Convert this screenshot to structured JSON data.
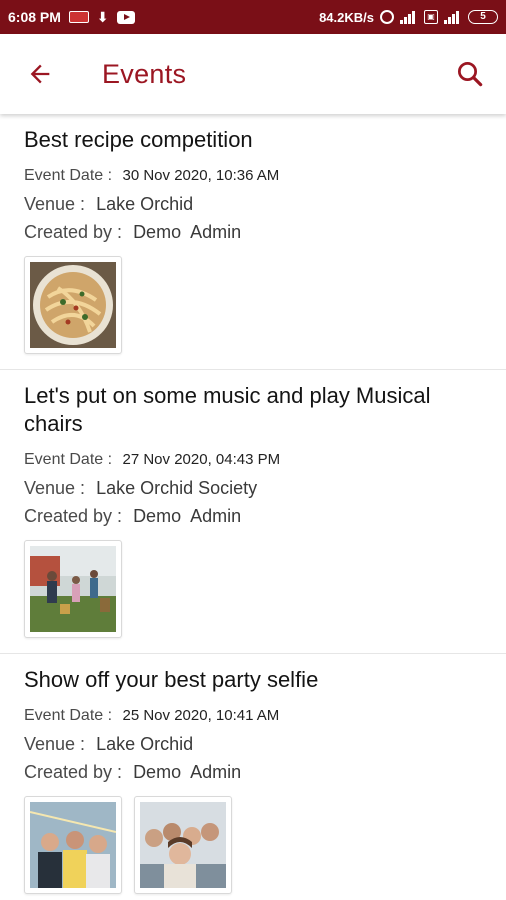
{
  "status_bar": {
    "time": "6:08 PM",
    "net_speed": "84.2KB/s",
    "battery": "5"
  },
  "header": {
    "title": "Events"
  },
  "labels": {
    "event_date": "Event Date : ",
    "venue": "Venue : ",
    "created_by": "Created by : "
  },
  "events": [
    {
      "title": "Best recipe competition",
      "date": "30 Nov 2020, 10:36 AM",
      "venue": "Lake Orchid",
      "created_by": "Demo  Admin"
    },
    {
      "title": "Let's put on some music and play Musical chairs",
      "date": "27 Nov 2020, 04:43 PM",
      "venue": "Lake Orchid Society",
      "created_by": "Demo  Admin"
    },
    {
      "title": "Show off your best party selfie",
      "date": "25 Nov 2020, 10:41 AM",
      "venue": "Lake Orchid",
      "created_by": "Demo  Admin"
    }
  ],
  "colors": {
    "status_bar_bg": "#7a0f17",
    "accent": "#9b1622"
  },
  "icons": {
    "back": "arrow-left-icon",
    "search": "search-icon"
  }
}
